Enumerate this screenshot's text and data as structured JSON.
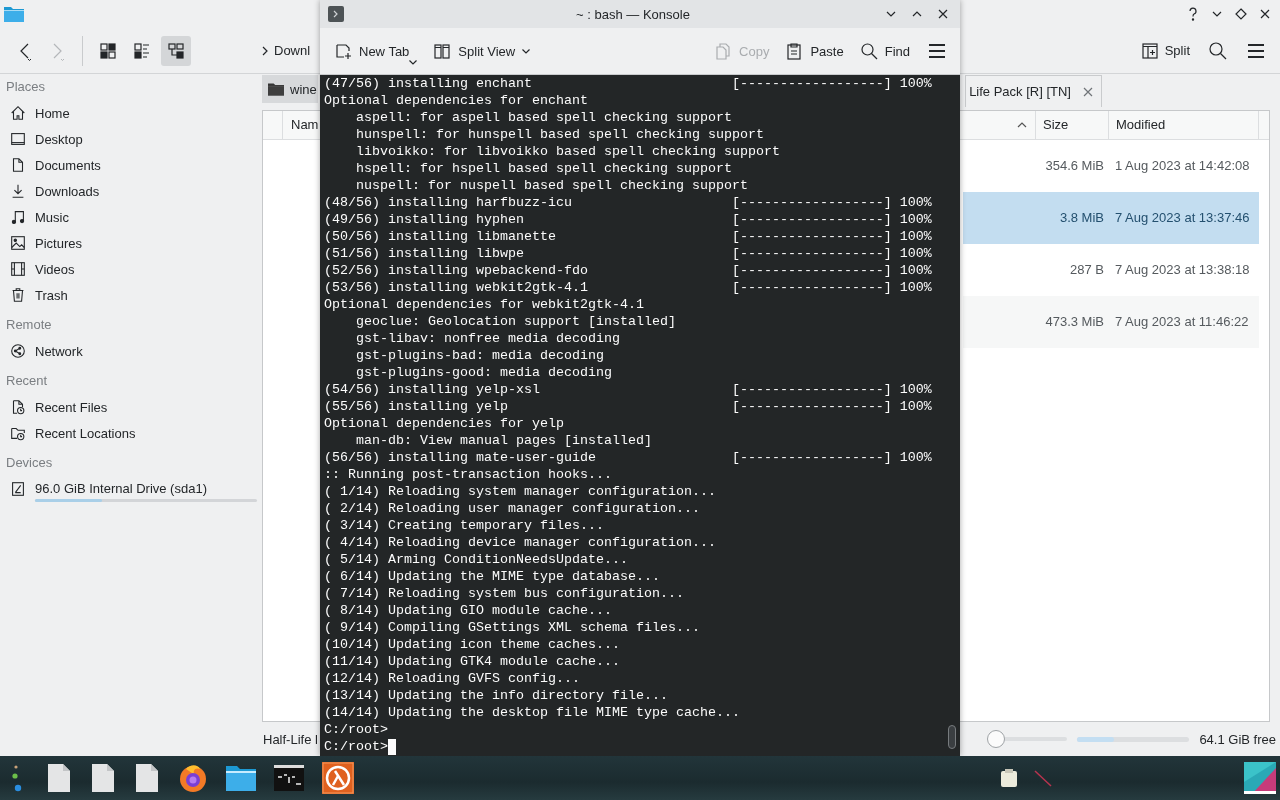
{
  "dolphin": {
    "view_modes": [
      {
        "selected": false
      },
      {
        "selected": false
      },
      {
        "selected": true
      }
    ],
    "breadcrumb": "Downl",
    "toolbar_buttons": [
      {
        "label": "Split"
      }
    ],
    "sidebar": [
      {
        "heading": "Places",
        "items": [
          {
            "label": "Home"
          },
          {
            "label": "Desktop"
          },
          {
            "label": "Documents"
          },
          {
            "label": "Downloads"
          },
          {
            "label": "Music"
          },
          {
            "label": "Pictures"
          },
          {
            "label": "Videos"
          },
          {
            "label": "Trash"
          }
        ]
      },
      {
        "heading": "Remote",
        "items": [
          {
            "label": "Network"
          }
        ]
      },
      {
        "heading": "Recent",
        "items": [
          {
            "label": "Recent Files"
          },
          {
            "label": "Recent Locations"
          }
        ]
      },
      {
        "heading": "Devices",
        "items": [
          {
            "label": "96.0 GiB Internal Drive (sda1)",
            "level": 0.3
          }
        ]
      }
    ],
    "tabs": [
      {
        "label": "wine",
        "selected": false
      },
      {
        "label": "Life Pack [R] [TN]",
        "selected": true
      }
    ],
    "table": {
      "columns": [
        "Nam",
        "Size",
        "Modified"
      ],
      "rows": [
        {
          "size": "354.6 MiB",
          "modified": "1 Aug 2023 at 14:42:08",
          "selected": false
        },
        {
          "size": "3.8 MiB",
          "modified": "7 Aug 2023 at 13:37:46",
          "selected": true
        },
        {
          "size": "287 B",
          "modified": "7 Aug 2023 at 13:38:18",
          "selected": false
        },
        {
          "size": "473.3 MiB",
          "modified": "7 Aug 2023 at 11:46:22",
          "selected": false
        }
      ]
    },
    "status_bar": {
      "text": "Half-Life l",
      "zoom": {
        "level": 0
      },
      "capacity": {
        "level": 0.33
      },
      "free": "64.1 GiB free"
    }
  },
  "konsole": {
    "title": "~ : bash — Konsole",
    "toolbar": [
      {
        "label": "New Tab",
        "disabled": false
      },
      {
        "label": "Split View",
        "disabled": false
      },
      {
        "label": "Copy",
        "disabled": true
      },
      {
        "label": "Paste",
        "disabled": false
      },
      {
        "label": "Find",
        "disabled": false
      }
    ],
    "lines": [
      {
        "kind": "progress",
        "text": "(47/56) installing enchant",
        "bar": "[------------------]",
        "percent": "100%"
      },
      {
        "kind": "plain",
        "text": "Optional dependencies for enchant"
      },
      {
        "kind": "sub",
        "text": "aspell: for aspell based spell checking support"
      },
      {
        "kind": "sub",
        "text": "hunspell: for hunspell based spell checking support"
      },
      {
        "kind": "sub",
        "text": "libvoikko: for libvoikko based spell checking support"
      },
      {
        "kind": "sub",
        "text": "hspell: for hspell based spell checking support"
      },
      {
        "kind": "sub",
        "text": "nuspell: for nuspell based spell checking support"
      },
      {
        "kind": "progress",
        "text": "(48/56) installing harfbuzz-icu",
        "bar": "[------------------]",
        "percent": "100%"
      },
      {
        "kind": "progress",
        "text": "(49/56) installing hyphen",
        "bar": "[------------------]",
        "percent": "100%"
      },
      {
        "kind": "progress",
        "text": "(50/56) installing libmanette",
        "bar": "[------------------]",
        "percent": "100%"
      },
      {
        "kind": "progress",
        "text": "(51/56) installing libwpe",
        "bar": "[------------------]",
        "percent": "100%"
      },
      {
        "kind": "progress",
        "text": "(52/56) installing wpebackend-fdo",
        "bar": "[------------------]",
        "percent": "100%"
      },
      {
        "kind": "progress",
        "text": "(53/56) installing webkit2gtk-4.1",
        "bar": "[------------------]",
        "percent": "100%"
      },
      {
        "kind": "plain",
        "text": "Optional dependencies for webkit2gtk-4.1"
      },
      {
        "kind": "sub",
        "text": "geoclue: Geolocation support [installed]"
      },
      {
        "kind": "sub",
        "text": "gst-libav: nonfree media decoding"
      },
      {
        "kind": "sub",
        "text": "gst-plugins-bad: media decoding"
      },
      {
        "kind": "sub",
        "text": "gst-plugins-good: media decoding"
      },
      {
        "kind": "progress",
        "text": "(54/56) installing yelp-xsl",
        "bar": "[------------------]",
        "percent": "100%"
      },
      {
        "kind": "progress",
        "text": "(55/56) installing yelp",
        "bar": "[------------------]",
        "percent": "100%"
      },
      {
        "kind": "plain",
        "text": "Optional dependencies for yelp"
      },
      {
        "kind": "sub",
        "text": "man-db: View manual pages [installed]"
      },
      {
        "kind": "progress",
        "text": "(56/56) installing mate-user-guide",
        "bar": "[------------------]",
        "percent": "100%"
      },
      {
        "kind": "plain",
        "text": ":: Running post-transaction hooks..."
      },
      {
        "kind": "plain",
        "text": "( 1/14) Reloading system manager configuration..."
      },
      {
        "kind": "plain",
        "text": "( 2/14) Reloading user manager configuration..."
      },
      {
        "kind": "plain",
        "text": "( 3/14) Creating temporary files..."
      },
      {
        "kind": "plain",
        "text": "( 4/14) Reloading device manager configuration..."
      },
      {
        "kind": "plain",
        "text": "( 5/14) Arming ConditionNeedsUpdate..."
      },
      {
        "kind": "plain",
        "text": "( 6/14) Updating the MIME type database..."
      },
      {
        "kind": "plain",
        "text": "( 7/14) Reloading system bus configuration..."
      },
      {
        "kind": "plain",
        "text": "( 8/14) Updating GIO module cache..."
      },
      {
        "kind": "plain",
        "text": "( 9/14) Compiling GSettings XML schema files..."
      },
      {
        "kind": "plain",
        "text": "(10/14) Updating icon theme caches..."
      },
      {
        "kind": "plain",
        "text": "(11/14) Updating GTK4 module cache..."
      },
      {
        "kind": "plain",
        "text": "(12/14) Reloading GVFS config..."
      },
      {
        "kind": "plain",
        "text": "(13/14) Updating the info directory file..."
      },
      {
        "kind": "plain",
        "text": "(14/14) Updating the desktop file MIME type cache..."
      },
      {
        "kind": "prompt",
        "text": "C:/root>",
        "cursor": false
      },
      {
        "kind": "prompt",
        "text": "C:/root>",
        "cursor": true
      }
    ]
  }
}
